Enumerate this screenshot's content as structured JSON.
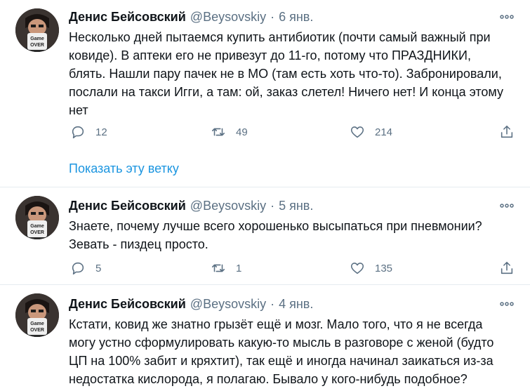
{
  "tweets": [
    {
      "author_name": "Денис Бейсовский",
      "handle": "@Beysovskiy",
      "separator": "·",
      "date": "6 янв.",
      "text": "Несколько дней пытаемся купить антибиотик (почти самый важный при\nковиде). В аптеки его не привезут до 11-го, потому что ПРАЗДНИКИ,\nблять. Нашли пару пачек не в МО (там есть хоть что-то). Забронировали,\nпослали на такси Игги, а там: ой, заказ слетел! Ничего нет! И конца этому\nнет",
      "replies": "12",
      "retweets": "49",
      "likes": "214",
      "show_thread": "Показать эту ветку"
    },
    {
      "author_name": "Денис Бейсовский",
      "handle": "@Beysovskiy",
      "separator": "·",
      "date": "5 янв.",
      "text": "Знаете, почему лучше всего хорошенько высыпаться при пневмонии?\nЗевать - пиздец просто.",
      "replies": "5",
      "retweets": "1",
      "likes": "135"
    },
    {
      "author_name": "Денис Бейсовский",
      "handle": "@Beysovskiy",
      "separator": "·",
      "date": "4 янв.",
      "text": "Кстати, ковид же знатно грызёт ещё и мозг. Мало того, что я не всегда\nмогу устно сформулировать какую-то мысль в разговоре с женой (будто\nЦП на 100% забит и кряхтит), так ещё и иногда начинал заикаться из-за\nнедостатка кислорода, я полагаю. Бывало у кого-нибудь подобное?"
    }
  ],
  "avatar_mug_text": [
    "Game",
    "OVER"
  ],
  "icons": {
    "reply": "reply-icon",
    "retweet": "retweet-icon",
    "like": "like-icon",
    "share": "share-icon",
    "more": "more-icon"
  },
  "colors": {
    "text": "#0f1419",
    "secondary": "#5b7083",
    "link": "#1b95e0",
    "divider": "#e6ecf0"
  }
}
